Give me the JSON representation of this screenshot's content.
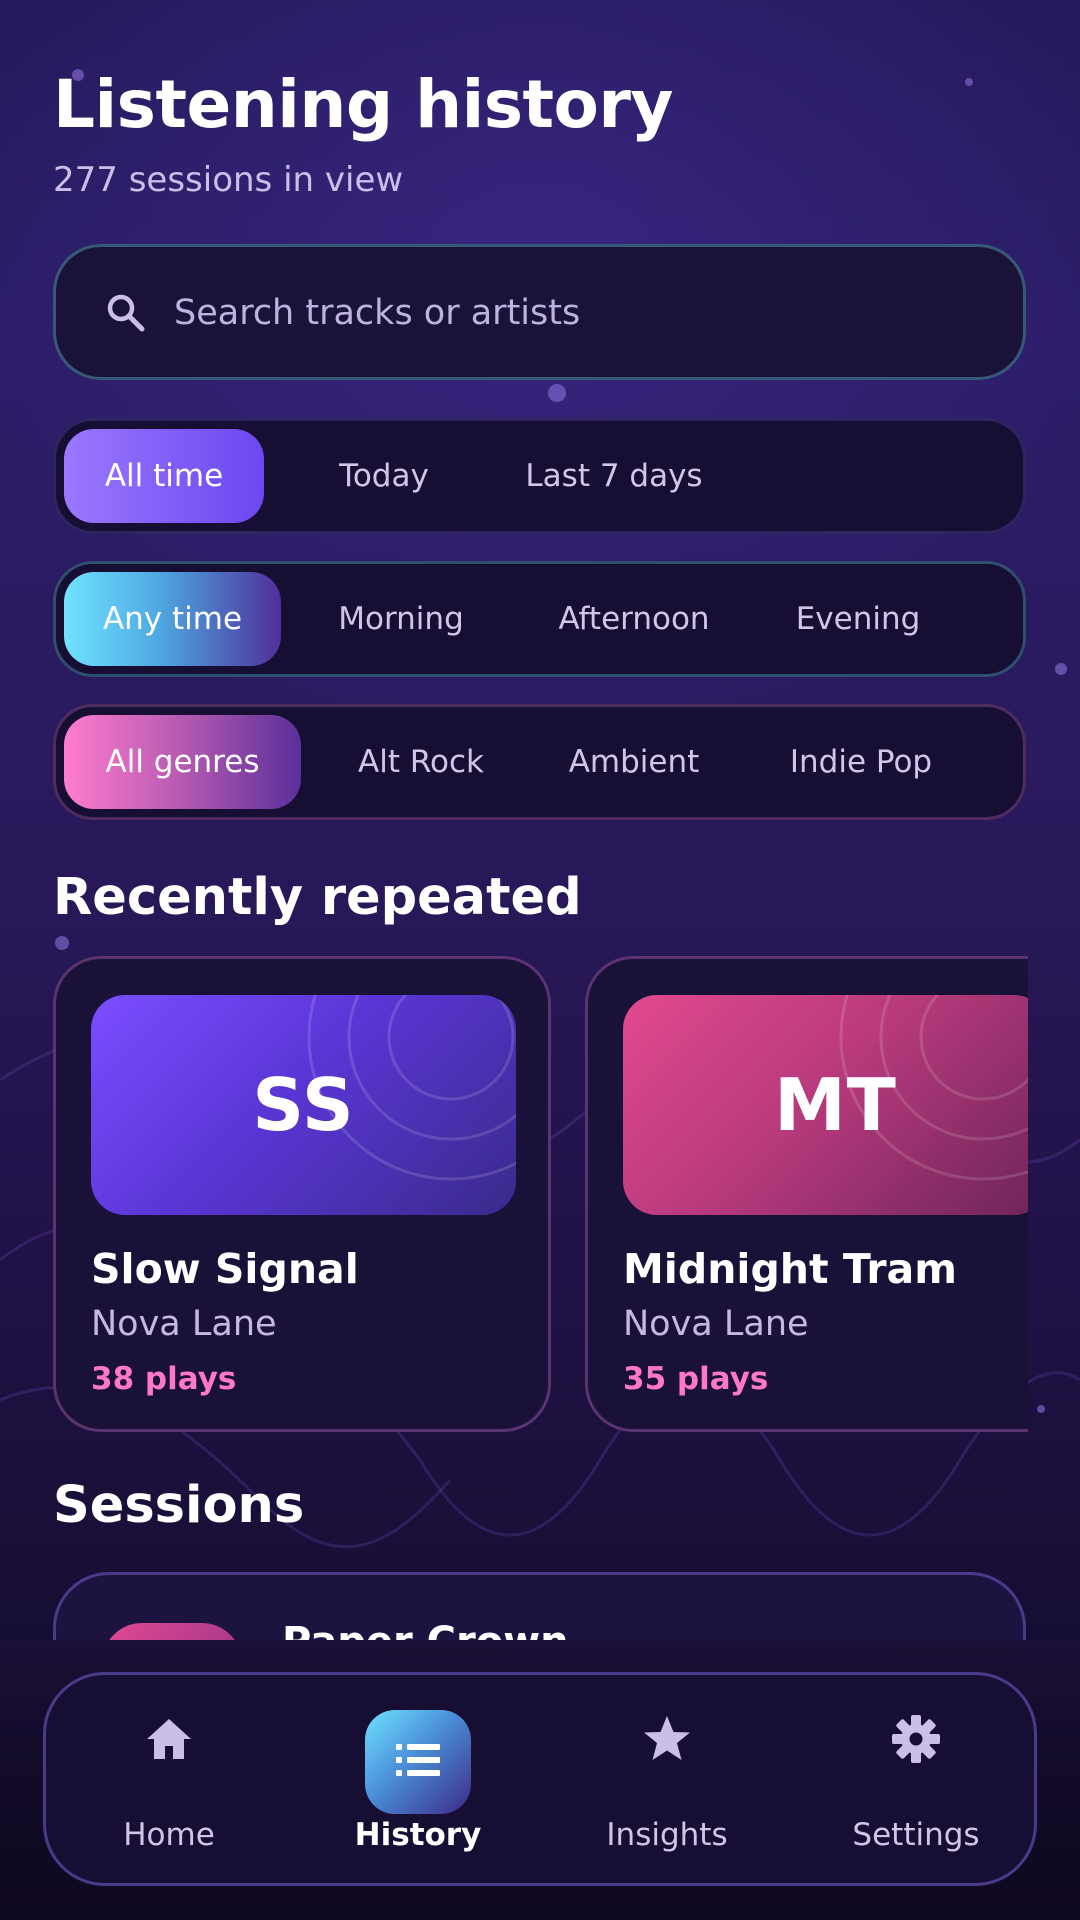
{
  "header": {
    "title": "Listening history",
    "subtitle": "277 sessions in view"
  },
  "search": {
    "placeholder": "Search tracks or artists",
    "value": "",
    "icon": "search-icon"
  },
  "filters": {
    "range": {
      "options": [
        "All time",
        "Today",
        "Last 7 days"
      ],
      "selected": "All time"
    },
    "time_of_day": {
      "options": [
        "Any time",
        "Morning",
        "Afternoon",
        "Evening"
      ],
      "selected": "Any time"
    },
    "genre": {
      "options": [
        "All genres",
        "Alt Rock",
        "Ambient",
        "Indie Pop"
      ],
      "selected": "All genres"
    }
  },
  "recently_repeated": {
    "title": "Recently repeated",
    "cards": [
      {
        "initials": "SS",
        "title": "Slow Signal",
        "artist": "Nova Lane",
        "plays": "38 plays",
        "color": "#7b4dff"
      },
      {
        "initials": "MT",
        "title": "Midnight Tram",
        "artist": "Nova Lane",
        "plays": "35 plays",
        "color": "#e2498f"
      }
    ]
  },
  "sessions": {
    "title": "Sessions",
    "items": [
      {
        "title": "Paper Crown"
      }
    ]
  },
  "bottom_nav": {
    "items": [
      {
        "label": "Home",
        "icon": "home-icon"
      },
      {
        "label": "History",
        "icon": "list-icon"
      },
      {
        "label": "Insights",
        "icon": "star-icon"
      },
      {
        "label": "Settings",
        "icon": "gear-icon"
      }
    ],
    "active": "History"
  },
  "colors": {
    "accent_purple": "#8b66ff",
    "accent_teal": "#6fe3ff",
    "accent_pink": "#ff78c8",
    "background": "#24195a"
  }
}
